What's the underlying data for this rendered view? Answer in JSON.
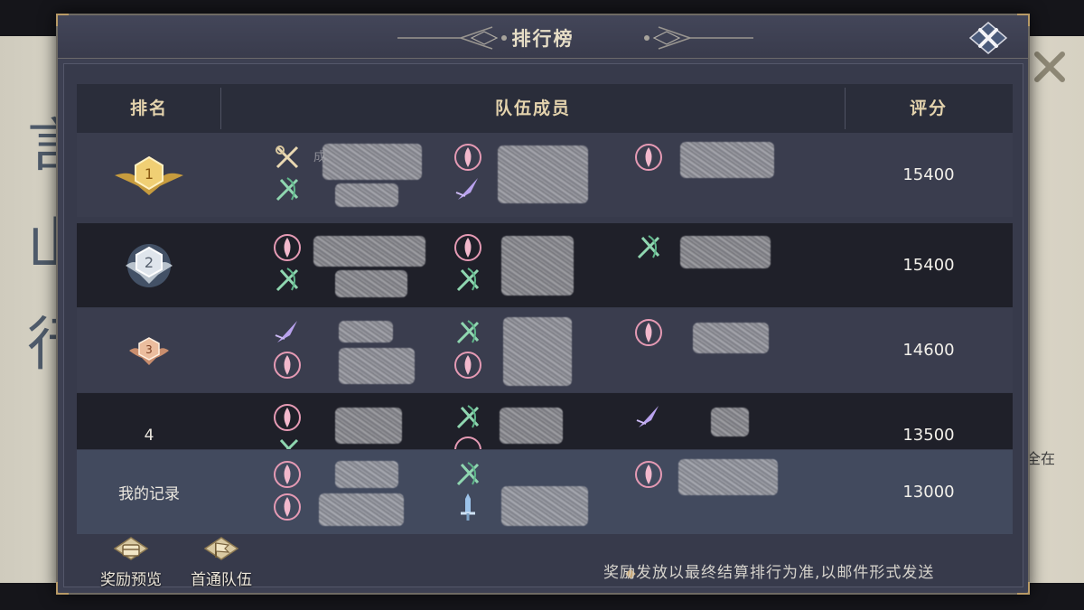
{
  "dialog": {
    "title": "排行榜",
    "close_icon": "close-x-icon"
  },
  "table": {
    "headers": {
      "rank": "排名",
      "members": "队伍成员",
      "score": "评分"
    },
    "rows": [
      {
        "rank": "1",
        "rank_style": "gold-medal",
        "score": "15400",
        "members": [
          {
            "icons": [
              "scissors-crossed-icon",
              "jade-swords-icon"
            ],
            "name_hint": "成"
          },
          {
            "icons": [
              "pink-flame-icon",
              "purple-blade-icon"
            ]
          },
          {
            "icons": [
              "pink-flame-icon"
            ]
          }
        ]
      },
      {
        "rank": "2",
        "rank_style": "silver-medal",
        "score": "15400",
        "members": [
          {
            "icons": [
              "pink-flame-icon",
              "jade-swords-icon"
            ]
          },
          {
            "icons": [
              "pink-flame-icon",
              "jade-swords-icon"
            ]
          },
          {
            "icons": [
              "jade-swords-icon"
            ]
          }
        ]
      },
      {
        "rank": "3",
        "rank_style": "bronze-medal",
        "score": "14600",
        "members": [
          {
            "icons": [
              "purple-blade-icon",
              "pink-flame-icon"
            ]
          },
          {
            "icons": [
              "jade-swords-icon",
              "pink-flame-icon"
            ]
          },
          {
            "icons": [
              "pink-flame-icon"
            ]
          }
        ]
      },
      {
        "rank": "4",
        "rank_style": "plain",
        "score": "13500",
        "members": [
          {
            "icons": [
              "pink-flame-icon",
              "jade-swords-icon"
            ]
          },
          {
            "icons": [
              "jade-swords-icon",
              "pink-flame-icon"
            ]
          },
          {
            "icons": [
              "purple-blade-icon"
            ]
          }
        ]
      }
    ],
    "my_record": {
      "label": "我的记录",
      "score": "13000",
      "members": [
        {
          "icons": [
            "pink-flame-icon",
            "pink-flame-icon"
          ]
        },
        {
          "icons": [
            "jade-swords-icon",
            "blue-sword-icon"
          ]
        },
        {
          "icons": [
            "pink-flame-icon"
          ]
        }
      ]
    }
  },
  "footer": {
    "reward_preview": "奖励预览",
    "first_clear_team": "首通队伍",
    "notice": "奖励发放以最终结算排行为准,以邮件形式发送"
  },
  "background": {
    "side_text": "全在"
  },
  "colors": {
    "gold_text": "#e4d3ad",
    "panel": "#373a4b",
    "dark_row": "#1f2029",
    "pink_icon": "#e59ab4",
    "jade_icon": "#8fd6b0",
    "purple_icon": "#b9a2ee"
  }
}
